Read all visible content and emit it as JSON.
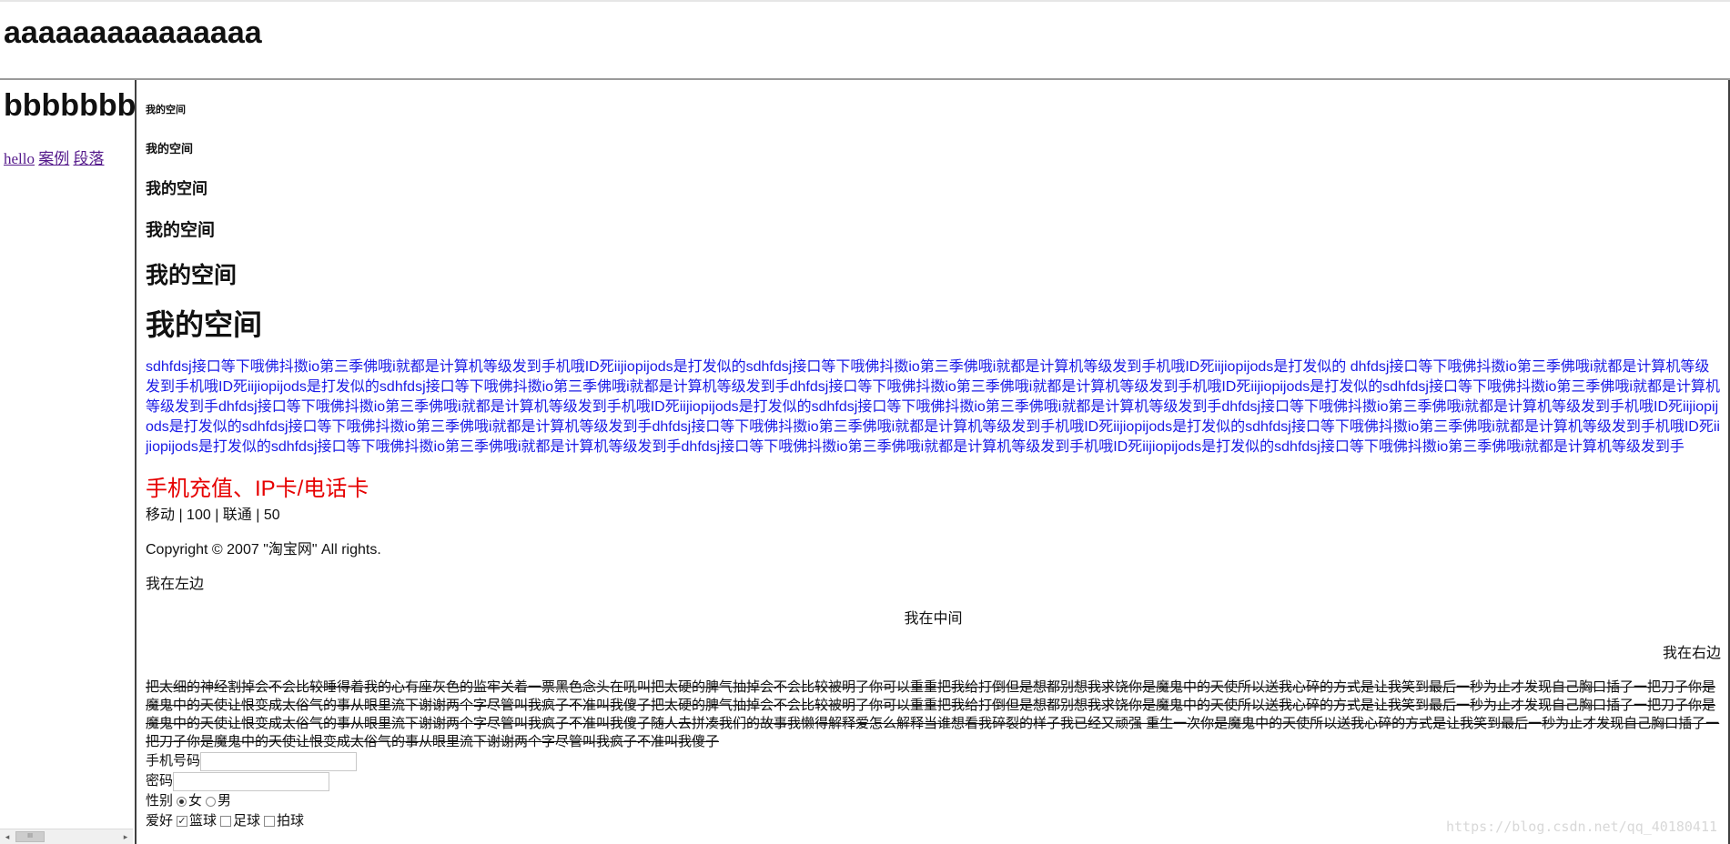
{
  "top": {
    "heading": "aaaaaaaaaaaaaaa"
  },
  "left": {
    "heading": "bbbbbbbbbbb",
    "links": [
      "hello",
      "案例",
      "段落"
    ],
    "scrollbar": {
      "left_arrow": "◂",
      "right_arrow": "▸",
      "thumb": "III"
    }
  },
  "main": {
    "headings": [
      "我的空间",
      "我的空间",
      "我的空间",
      "我的空间",
      "我的空间",
      "我的空间"
    ],
    "blue_paragraph": "sdhfdsj接口等下哦佛抖擞io第三季佛哦i就都是计算机等级发到手机哦ID死iijiopijods是打发似的sdhfdsj接口等下哦佛抖擞io第三季佛哦i就都是计算机等级发到手机哦ID死iijiopijods是打发似的 dhfdsj接口等下哦佛抖擞io第三季佛哦i就都是计算机等级发到手机哦ID死iijiopijods是打发似的sdhfdsj接口等下哦佛抖擞io第三季佛哦i就都是计算机等级发到手dhfdsj接口等下哦佛抖擞io第三季佛哦i就都是计算机等级发到手机哦ID死iijiopijods是打发似的sdhfdsj接口等下哦佛抖擞io第三季佛哦i就都是计算机等级发到手dhfdsj接口等下哦佛抖擞io第三季佛哦i就都是计算机等级发到手机哦ID死iijiopijods是打发似的sdhfdsj接口等下哦佛抖擞io第三季佛哦i就都是计算机等级发到手dhfdsj接口等下哦佛抖擞io第三季佛哦i就都是计算机等级发到手机哦ID死iijiopijods是打发似的sdhfdsj接口等下哦佛抖擞io第三季佛哦i就都是计算机等级发到手dhfdsj接口等下哦佛抖擞io第三季佛哦i就都是计算机等级发到手机哦ID死iijiopijods是打发似的sdhfdsj接口等下哦佛抖擞io第三季佛哦i就都是计算机等级发到手机哦ID死iijiopijods是打发似的sdhfdsj接口等下哦佛抖擞io第三季佛哦i就都是计算机等级发到手dhfdsj接口等下哦佛抖擞io第三季佛哦i就都是计算机等级发到手机哦ID死iijiopijods是打发似的sdhfdsj接口等下哦佛抖擞io第三季佛哦i就都是计算机等级发到手",
    "red_heading": "手机充值、IP卡/电话卡",
    "phone_line": "移动 |  100 |  联通 |  50",
    "copyright": "Copyright © 2007 \"淘宝网\" All rights.",
    "left_text": "我在左边",
    "center_text": "我在中间",
    "right_text": "我在右边",
    "strike_paragraph": "把太细的神经割掉会不会比较睡得着我的心有座灰色的监牢关着一票黑色念头在吼叫把太硬的脾气抽掉会不会比较被明了你可以重重把我给打倒但是想都别想我求饶你是魔鬼中的天使所以送我心碎的方式是让我笑到最后一秒为止才发现自己胸口插了一把刀子你是魔鬼中的天使让恨变成太俗气的事从眼里流下谢谢两个字尽管叫我疯子不准叫我傻子把太硬的脾气抽掉会不会比较被明了你可以重重把我给打倒但是想都别想我求饶你是魔鬼中的天使所以送我心碎的方式是让我笑到最后一秒为止才发现自己胸口插了一把刀子你是魔鬼中的天使让恨变成太俗气的事从眼里流下谢谢两个字尽管叫我疯子不准叫我傻子随人去拼凑我们的故事我懒得解释爱怎么解释当谁想看我碎裂的样子我已经又顽强 重生一次你是魔鬼中的天使所以送我心碎的方式是让我笑到最后一秒为止才发现自己胸口插了一把刀子你是魔鬼中的天使让恨变成太俗气的事从眼里流下谢谢两个字尽管叫我疯子不准叫我傻子",
    "form": {
      "phone_label": "手机号码",
      "phone_value": "",
      "password_label": "密码",
      "password_value": "",
      "gender_label": "性别",
      "gender_options": [
        {
          "label": "女",
          "checked": true
        },
        {
          "label": "男",
          "checked": false
        }
      ],
      "hobby_label": "爱好",
      "hobby_options": [
        {
          "label": "篮球",
          "checked": true
        },
        {
          "label": "足球",
          "checked": false
        },
        {
          "label": "拍球",
          "checked": false
        }
      ],
      "check_mark": "✓"
    }
  },
  "watermark": "https://blog.csdn.net/qq_40180411"
}
